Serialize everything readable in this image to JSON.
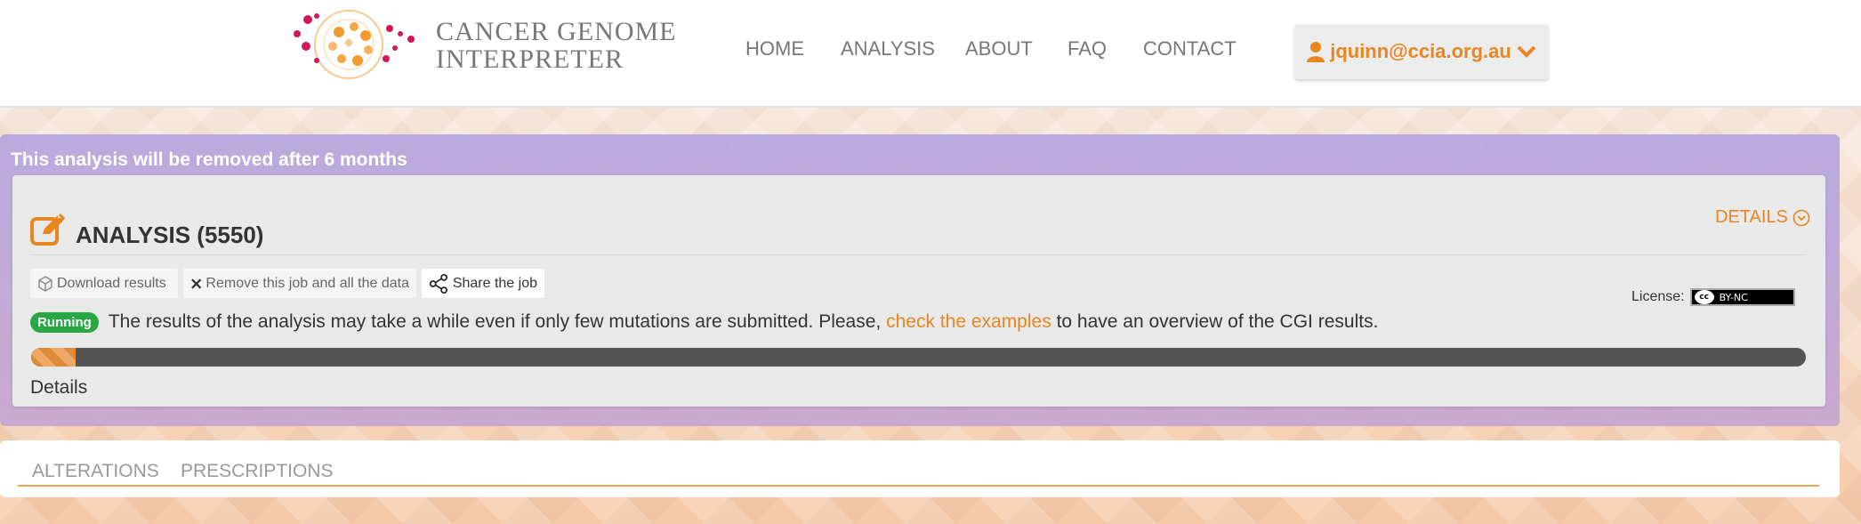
{
  "header": {
    "logo_line1": "CANCER GENOME",
    "logo_line2": "INTERPRETER",
    "nav": [
      "HOME",
      "ANALYSIS",
      "ABOUT",
      "FAQ",
      "CONTACT"
    ],
    "user_email": "jquinn@ccia.org.au"
  },
  "notice": "This analysis will be removed after 6 months",
  "analysis": {
    "title": "ANALYSIS (5550)",
    "details_toggle": "DETAILS",
    "actions": {
      "download": "Download results",
      "remove": "Remove this job and all the data",
      "share": "Share the job"
    },
    "license_label": "License:",
    "license_badge": "BY-NC",
    "status_badge": "Running",
    "status_text_before": "The results of the analysis may take a while even if only few mutations are submitted. Please,",
    "status_link": "check the examples",
    "status_text_after": "to have an overview of the CGI results.",
    "progress_fraction": 0.025,
    "details_label": "Details"
  },
  "tabs": [
    "ALTERATIONS",
    "PRESCRIPTIONS"
  ],
  "colors": {
    "accent": "#e8861f",
    "running": "#28a745",
    "progress_track": "#555555"
  }
}
